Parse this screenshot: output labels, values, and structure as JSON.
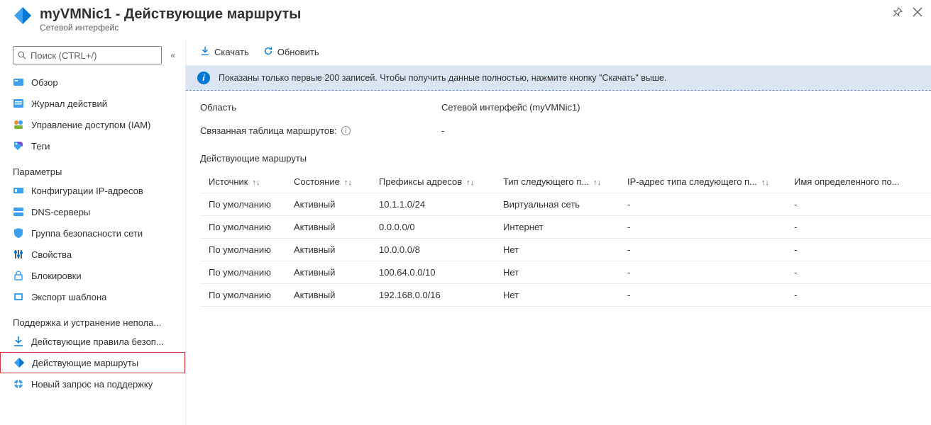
{
  "header": {
    "title": "myVMNic1 - Действующие маршруты",
    "subtitle": "Сетевой интерфейс"
  },
  "search": {
    "placeholder": "Поиск (CTRL+/)"
  },
  "sidebar": {
    "items": [
      {
        "label": "Обзор",
        "icon": "overview"
      },
      {
        "label": "Журнал действий",
        "icon": "activity"
      },
      {
        "label": "Управление доступом (IAM)",
        "icon": "iam"
      },
      {
        "label": "Теги",
        "icon": "tags"
      }
    ],
    "section_settings": "Параметры",
    "settings": [
      {
        "label": "Конфигурации IP-адресов",
        "icon": "ipconfig"
      },
      {
        "label": "DNS-серверы",
        "icon": "dns"
      },
      {
        "label": "Группа безопасности сети",
        "icon": "nsg"
      },
      {
        "label": "Свойства",
        "icon": "properties"
      },
      {
        "label": "Блокировки",
        "icon": "locks"
      },
      {
        "label": "Экспорт шаблона",
        "icon": "export"
      }
    ],
    "section_support": "Поддержка и устранение непола...",
    "support": [
      {
        "label": "Действующие правила безоп...",
        "icon": "sec-rules"
      },
      {
        "label": "Действующие маршруты",
        "icon": "routes",
        "selected": true
      },
      {
        "label": "Новый запрос на поддержку",
        "icon": "support"
      }
    ]
  },
  "toolbar": {
    "download": "Скачать",
    "refresh": "Обновить"
  },
  "info": {
    "message": "Показаны только первые 200 записей. Чтобы получить данные полностью, нажмите кнопку \"Скачать\" выше."
  },
  "details": {
    "scope_label": "Область",
    "scope_value": "Сетевой интерфейс (myVMNic1)",
    "route_table_label": "Связанная таблица маршрутов:",
    "route_table_value": "-"
  },
  "table": {
    "title": "Действующие маршруты",
    "columns": [
      "Источник",
      "Состояние",
      "Префиксы адресов",
      "Тип следующего п...",
      "IP-адрес типа следующего п...",
      "Имя определенного по..."
    ],
    "rows": [
      {
        "source": "По умолчанию",
        "state": "Активный",
        "prefix": "10.1.1.0/24",
        "nhtype": "Виртуальная сеть",
        "nhip": "-",
        "name": "-"
      },
      {
        "source": "По умолчанию",
        "state": "Активный",
        "prefix": "0.0.0.0/0",
        "nhtype": "Интернет",
        "nhip": "-",
        "name": "-"
      },
      {
        "source": "По умолчанию",
        "state": "Активный",
        "prefix": "10.0.0.0/8",
        "nhtype": "Нет",
        "nhip": "-",
        "name": "-"
      },
      {
        "source": "По умолчанию",
        "state": "Активный",
        "prefix": "100.64.0.0/10",
        "nhtype": "Нет",
        "nhip": "-",
        "name": "-"
      },
      {
        "source": "По умолчанию",
        "state": "Активный",
        "prefix": "192.168.0.0/16",
        "nhtype": "Нет",
        "nhip": "-",
        "name": "-"
      }
    ]
  }
}
